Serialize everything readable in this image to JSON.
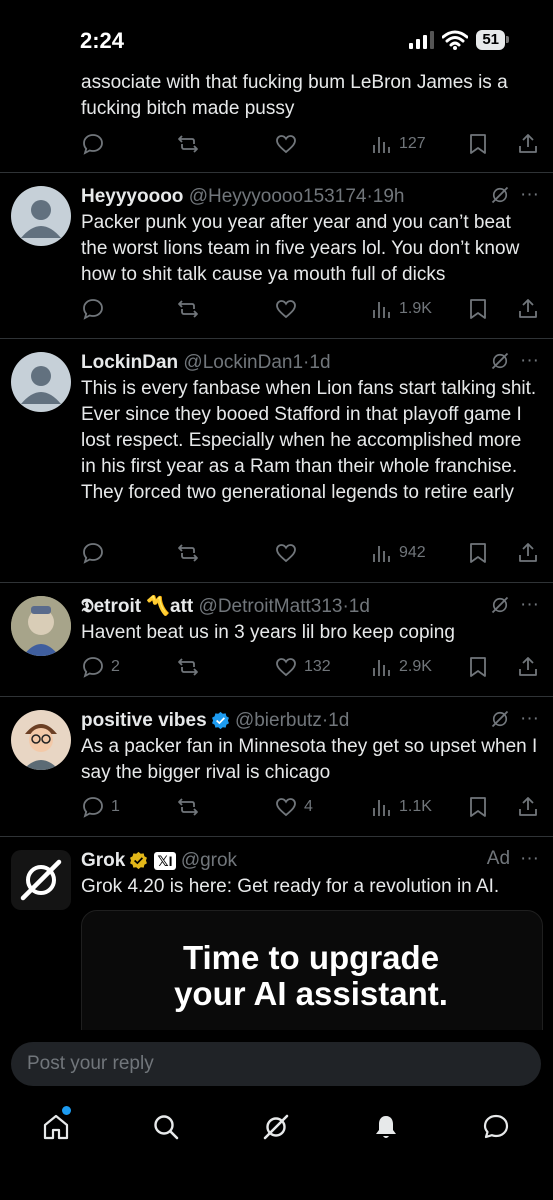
{
  "status_bar": {
    "time": "2:24",
    "battery": "51"
  },
  "posts": [
    {
      "text": "associate with that fucking bum LeBron James is a fucking bitch made pussy",
      "replies": "",
      "likes": "",
      "views": "127"
    },
    {
      "name": "Heyyyoooo",
      "handle": "@Heyyyoooo153174",
      "dot": "·",
      "time": "19h",
      "text": "Packer punk you year after year and you can’t beat the worst lions team in five years lol. You don’t know how to shit talk cause ya mouth full of dicks",
      "replies": "",
      "likes": "",
      "views": "1.9K"
    },
    {
      "name": "LockinDan",
      "handle": "@LockinDan1",
      "dot": "·",
      "time": "1d",
      "text": "This is every fanbase when Lion fans start talking shit. Ever since they booed Stafford in that playoff game I lost respect. Especially when he accomplished more in his first year as a Ram than their whole franchise. They forced two generational legends to retire early",
      "replies": "",
      "likes": "",
      "views": "942"
    },
    {
      "name": "𝕯etroit 〽️att",
      "handle": "@DetroitMatt313",
      "dot": "·",
      "time": "1d",
      "text": "Havent beat us in 3 years lil bro keep coping",
      "replies": "2",
      "likes": "132",
      "views": "2.9K"
    },
    {
      "name": "positive vibes",
      "handle": "@bierbutz",
      "dot": "·",
      "time": "1d",
      "text": "As a packer fan in Minnesota they get so upset when I say the bigger rival is chicago",
      "replies": "1",
      "likes": "4",
      "views": "1.1K"
    }
  ],
  "ad": {
    "name": "Grok",
    "affiliate": "𝕏I",
    "handle": "@grok",
    "label": "Ad",
    "text": "Grok 4.20 is here: Get ready for a revolution in AI.",
    "card_title_1": "Time to upgrade",
    "card_title_2": "your AI assistant."
  },
  "reply": {
    "placeholder": "Post your reply"
  },
  "more_glyph": "···",
  "colors": {
    "background": "#000000",
    "text": "#e7e9ea",
    "muted": "#71767b",
    "accent": "#1d9bf0",
    "verified_gold": "#e2b719",
    "verified_blue": "#1d9bf0"
  },
  "icons": [
    "reply-icon",
    "repost-icon",
    "like-icon",
    "views-icon",
    "bookmark-icon",
    "share-icon",
    "grok-icon",
    "home-icon",
    "search-icon",
    "notifications-icon",
    "messages-icon"
  ]
}
